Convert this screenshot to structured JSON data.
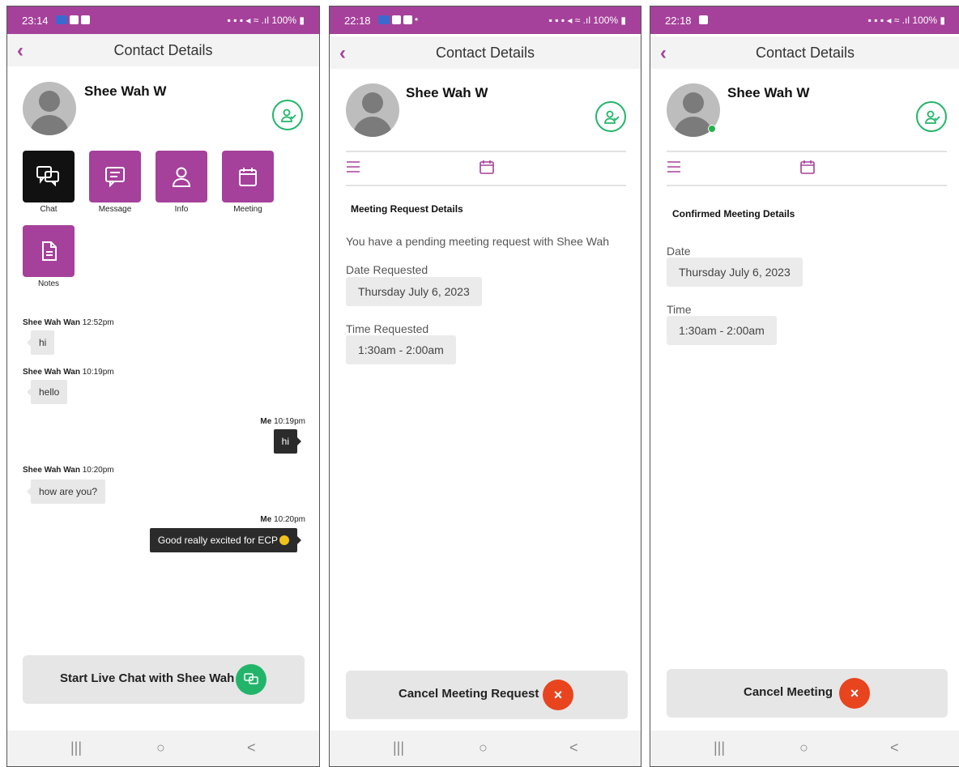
{
  "screens": [
    {
      "status": {
        "time": "23:14",
        "battery": "100%"
      },
      "header": {
        "title": "Contact Details"
      },
      "contact": {
        "name": "Shee Wah W"
      },
      "tiles": [
        "Chat",
        "Message",
        "Info",
        "Meeting",
        "Notes"
      ],
      "messages": [
        {
          "sender": "Shee Wah Wan",
          "time": "12:52pm",
          "text": "hi"
        },
        {
          "sender": "Shee Wah Wan",
          "time": "10:19pm",
          "text": "hello"
        },
        {
          "sender": "Me",
          "time": "10:19pm",
          "text": "hi"
        },
        {
          "sender": "Shee Wah Wan",
          "time": "10:20pm",
          "text": "how are you?"
        },
        {
          "sender": "Me",
          "time": "10:20pm",
          "text": "Good really excited for ECP"
        }
      ],
      "action_button": "Start Live Chat with Shee Wah"
    },
    {
      "status": {
        "time": "22:18",
        "battery": "100%"
      },
      "header": {
        "title": "Contact Details"
      },
      "contact": {
        "name": "Shee Wah W"
      },
      "section_title": "Meeting Request Details",
      "pending_text": "You have a pending meeting request with Shee Wah",
      "date_label": "Date Requested",
      "date_value": "Thursday July 6, 2023",
      "time_label": "Time Requested",
      "time_value": "1:30am - 2:00am",
      "action_button": "Cancel Meeting Request",
      "action_icon": "×"
    },
    {
      "status": {
        "time": "22:18",
        "battery": "100%"
      },
      "header": {
        "title": "Contact Details"
      },
      "contact": {
        "name": "Shee Wah W"
      },
      "section_title": "Confirmed Meeting Details",
      "date_label": "Date",
      "date_value": "Thursday July 6, 2023",
      "time_label": "Time",
      "time_value": "1:30am - 2:00am",
      "action_button": "Cancel Meeting",
      "action_icon": "×"
    }
  ],
  "navbar": {
    "recent": "|||",
    "home": "○",
    "back": "<"
  },
  "colors": {
    "brand": "#a5419a",
    "green": "#22b56a",
    "red": "#e8441e"
  }
}
